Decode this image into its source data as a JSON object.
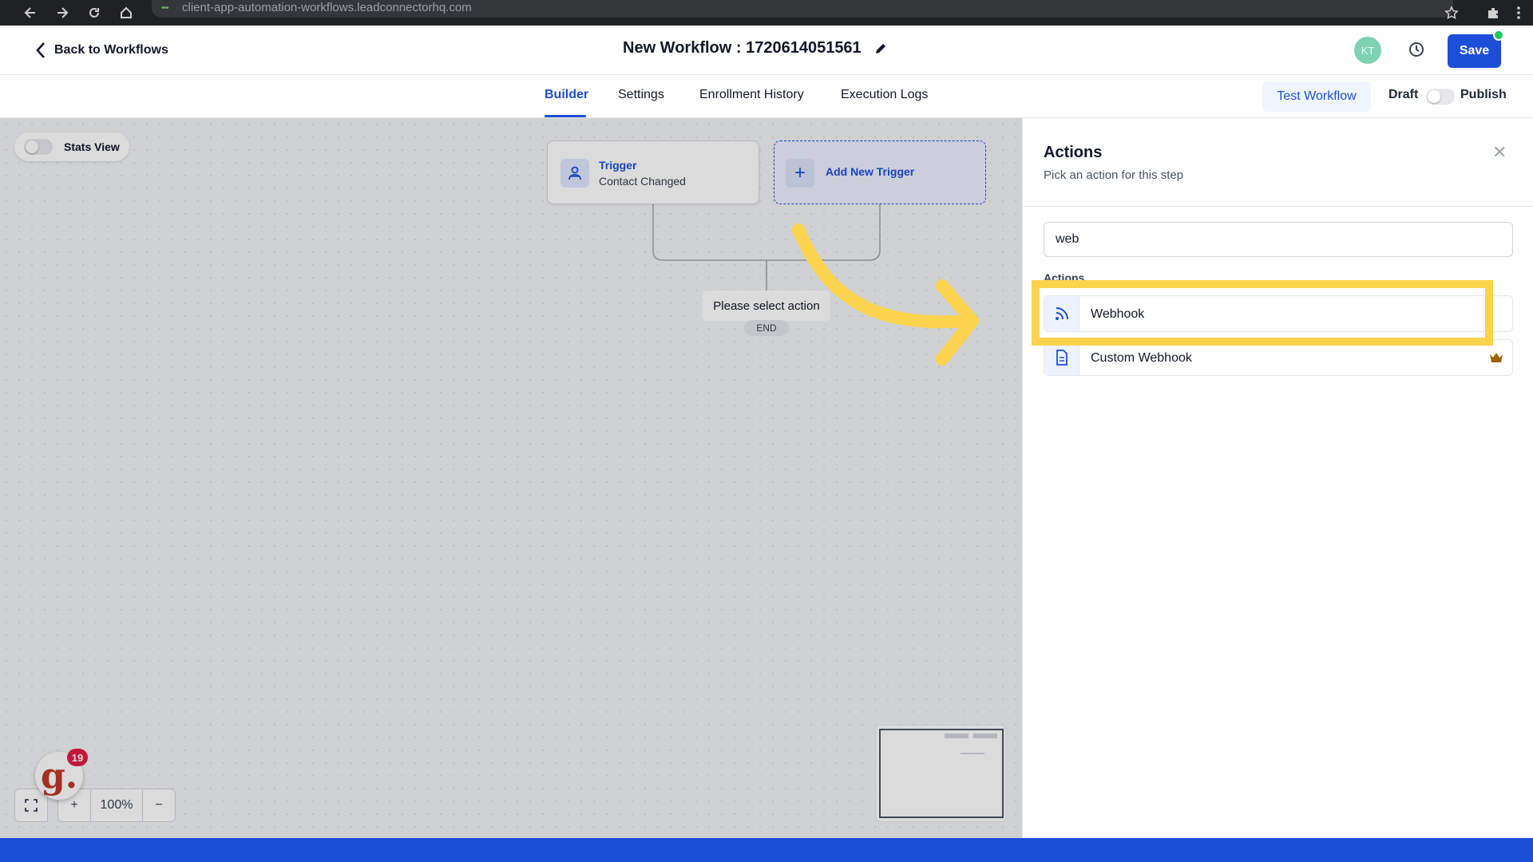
{
  "browser": {
    "url": "client-app-automation-workflows.leadconnectorhq.com"
  },
  "header": {
    "back_label": "Back to Workflows",
    "title": "New Workflow : 1720614051561",
    "avatar_initials": "KT",
    "save_label": "Save"
  },
  "tabs": [
    {
      "label": "Builder",
      "active": true
    },
    {
      "label": "Settings",
      "active": false
    },
    {
      "label": "Enrollment History",
      "active": false
    },
    {
      "label": "Execution Logs",
      "active": false
    }
  ],
  "toolbar": {
    "test_label": "Test Workflow",
    "draft_label": "Draft",
    "publish_label": "Publish",
    "publish_on": false
  },
  "canvas": {
    "stats_label": "Stats View",
    "stats_on": false,
    "trigger": {
      "label": "Trigger",
      "subtitle": "Contact Changed"
    },
    "add_trigger_label": "Add New Trigger",
    "select_action": "Please select action",
    "end_label": "END",
    "zoom": "100%",
    "notification_count": "19"
  },
  "panel": {
    "title": "Actions",
    "subtitle": "Pick an action for this step",
    "search_value": "web",
    "section_label": "Actions",
    "items": [
      {
        "label": "Webhook",
        "icon": "rss-icon",
        "premium": false
      },
      {
        "label": "Custom Webhook",
        "icon": "document-icon",
        "premium": true
      }
    ]
  },
  "colors": {
    "accent": "#1d4ed8",
    "highlight": "#fcd34d",
    "status_online": "#22c55e"
  }
}
